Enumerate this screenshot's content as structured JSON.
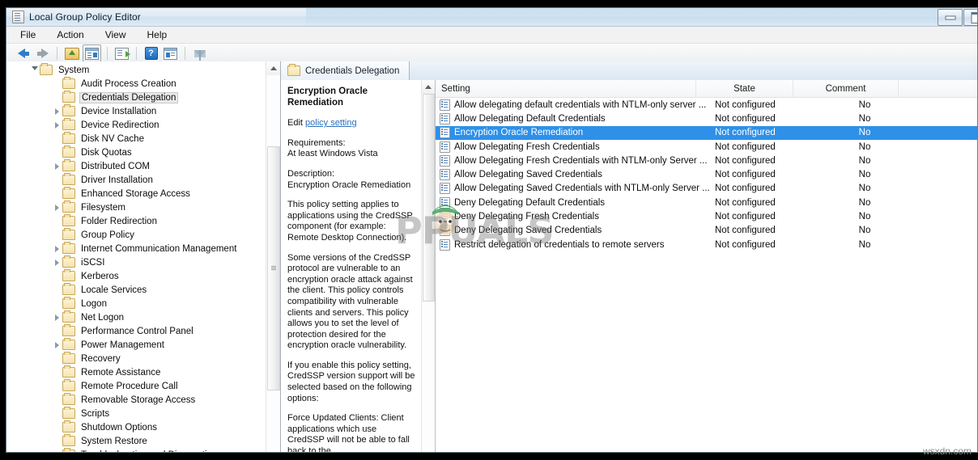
{
  "window": {
    "title": "Local Group Policy Editor",
    "icon": "console-icon",
    "buttons": [
      {
        "name": "minimize-button",
        "glyph": "minimize"
      },
      {
        "name": "maximize-button",
        "glyph": "maximize"
      }
    ]
  },
  "menu": {
    "items": [
      {
        "label": "File",
        "name": "menu-file"
      },
      {
        "label": "Action",
        "name": "menu-action"
      },
      {
        "label": "View",
        "name": "menu-view"
      },
      {
        "label": "Help",
        "name": "menu-help"
      }
    ]
  },
  "toolbar": {
    "buttons": [
      {
        "name": "back-button",
        "icon": "back-arrow-icon"
      },
      {
        "name": "forward-button",
        "icon": "forward-arrow-icon"
      },
      {
        "name": "up-one-level-button",
        "icon": "folder-up-icon"
      },
      {
        "name": "show-hide-console-tree-button",
        "icon": "console-tree-icon"
      },
      {
        "name": "export-list-button",
        "icon": "export-icon"
      },
      {
        "name": "help-button",
        "icon": "help-icon"
      },
      {
        "name": "properties-button",
        "icon": "properties-icon"
      },
      {
        "name": "filter-button",
        "icon": "filter-icon"
      }
    ]
  },
  "tree": {
    "items": [
      {
        "label": "System",
        "indent": 0,
        "twisty": "expanded",
        "selected": false
      },
      {
        "label": "Audit Process Creation",
        "indent": 1,
        "twisty": "none",
        "selected": false
      },
      {
        "label": "Credentials Delegation",
        "indent": 1,
        "twisty": "none",
        "selected": true
      },
      {
        "label": "Device Installation",
        "indent": 1,
        "twisty": "collapsed",
        "selected": false
      },
      {
        "label": "Device Redirection",
        "indent": 1,
        "twisty": "collapsed",
        "selected": false
      },
      {
        "label": "Disk NV Cache",
        "indent": 1,
        "twisty": "none",
        "selected": false
      },
      {
        "label": "Disk Quotas",
        "indent": 1,
        "twisty": "none",
        "selected": false
      },
      {
        "label": "Distributed COM",
        "indent": 1,
        "twisty": "collapsed",
        "selected": false
      },
      {
        "label": "Driver Installation",
        "indent": 1,
        "twisty": "none",
        "selected": false
      },
      {
        "label": "Enhanced Storage Access",
        "indent": 1,
        "twisty": "none",
        "selected": false
      },
      {
        "label": "Filesystem",
        "indent": 1,
        "twisty": "collapsed",
        "selected": false
      },
      {
        "label": "Folder Redirection",
        "indent": 1,
        "twisty": "none",
        "selected": false
      },
      {
        "label": "Group Policy",
        "indent": 1,
        "twisty": "none",
        "selected": false
      },
      {
        "label": "Internet Communication Management",
        "indent": 1,
        "twisty": "collapsed",
        "selected": false
      },
      {
        "label": "iSCSI",
        "indent": 1,
        "twisty": "collapsed",
        "selected": false
      },
      {
        "label": "Kerberos",
        "indent": 1,
        "twisty": "none",
        "selected": false
      },
      {
        "label": "Locale Services",
        "indent": 1,
        "twisty": "none",
        "selected": false
      },
      {
        "label": "Logon",
        "indent": 1,
        "twisty": "none",
        "selected": false
      },
      {
        "label": "Net Logon",
        "indent": 1,
        "twisty": "collapsed",
        "selected": false
      },
      {
        "label": "Performance Control Panel",
        "indent": 1,
        "twisty": "none",
        "selected": false
      },
      {
        "label": "Power Management",
        "indent": 1,
        "twisty": "collapsed",
        "selected": false
      },
      {
        "label": "Recovery",
        "indent": 1,
        "twisty": "none",
        "selected": false
      },
      {
        "label": "Remote Assistance",
        "indent": 1,
        "twisty": "none",
        "selected": false
      },
      {
        "label": "Remote Procedure Call",
        "indent": 1,
        "twisty": "none",
        "selected": false
      },
      {
        "label": "Removable Storage Access",
        "indent": 1,
        "twisty": "none",
        "selected": false
      },
      {
        "label": "Scripts",
        "indent": 1,
        "twisty": "none",
        "selected": false
      },
      {
        "label": "Shutdown Options",
        "indent": 1,
        "twisty": "none",
        "selected": false
      },
      {
        "label": "System Restore",
        "indent": 1,
        "twisty": "none",
        "selected": false
      },
      {
        "label": "Troubleshooting and Diagnostics",
        "indent": 1,
        "twisty": "collapsed",
        "selected": false
      }
    ]
  },
  "tab": {
    "label": "Credentials Delegation",
    "icon": "folder-icon"
  },
  "detail": {
    "heading": "Encryption Oracle Remediation",
    "edit_prefix": "Edit ",
    "edit_link": "policy setting",
    "requirements_label": "Requirements:",
    "requirements_value": "At least Windows Vista",
    "description_label": "Description:",
    "description_value": "Encryption Oracle Remediation",
    "paragraphs": [
      "This policy setting applies to applications using the CredSSP component (for example: Remote Desktop Connection).",
      "Some versions of the CredSSP protocol are vulnerable to an encryption oracle attack against the client.  This policy controls compatibility with vulnerable clients and servers.  This policy allows you to set the level of protection desired for the encryption oracle vulnerability.",
      "If you enable this policy setting, CredSSP version support will be selected based on the following options:",
      "Force Updated Clients: Client applications which use CredSSP will not be able to fall back to the"
    ]
  },
  "list": {
    "columns": [
      {
        "label": "Setting",
        "name": "column-setting"
      },
      {
        "label": "State",
        "name": "column-state"
      },
      {
        "label": "Comment",
        "name": "column-comment"
      }
    ],
    "rows": [
      {
        "setting": "Allow delegating default credentials with NTLM-only server ...",
        "state": "Not configured",
        "comment": "No",
        "selected": false
      },
      {
        "setting": "Allow Delegating Default Credentials",
        "state": "Not configured",
        "comment": "No",
        "selected": false
      },
      {
        "setting": "Encryption Oracle Remediation",
        "state": "Not configured",
        "comment": "No",
        "selected": true
      },
      {
        "setting": "Allow Delegating Fresh Credentials",
        "state": "Not configured",
        "comment": "No",
        "selected": false
      },
      {
        "setting": "Allow Delegating Fresh Credentials with NTLM-only Server ...",
        "state": "Not configured",
        "comment": "No",
        "selected": false
      },
      {
        "setting": "Allow Delegating Saved Credentials",
        "state": "Not configured",
        "comment": "No",
        "selected": false
      },
      {
        "setting": "Allow Delegating Saved Credentials with NTLM-only Server ...",
        "state": "Not configured",
        "comment": "No",
        "selected": false
      },
      {
        "setting": "Deny Delegating Default Credentials",
        "state": "Not configured",
        "comment": "No",
        "selected": false
      },
      {
        "setting": "Deny Delegating Fresh Credentials",
        "state": "Not configured",
        "comment": "No",
        "selected": false
      },
      {
        "setting": "Deny Delegating Saved Credentials",
        "state": "Not configured",
        "comment": "No",
        "selected": false
      },
      {
        "setting": "Restrict delegation of credentials to remote servers",
        "state": "Not configured",
        "comment": "No",
        "selected": false
      }
    ]
  },
  "watermarks": {
    "center": "PPUALS",
    "corner": "wsxdn.com"
  },
  "colors": {
    "selection_blue": "#2e90e8",
    "link_blue": "#2b6fbd",
    "folder_yellow": "#f6e3ae"
  }
}
